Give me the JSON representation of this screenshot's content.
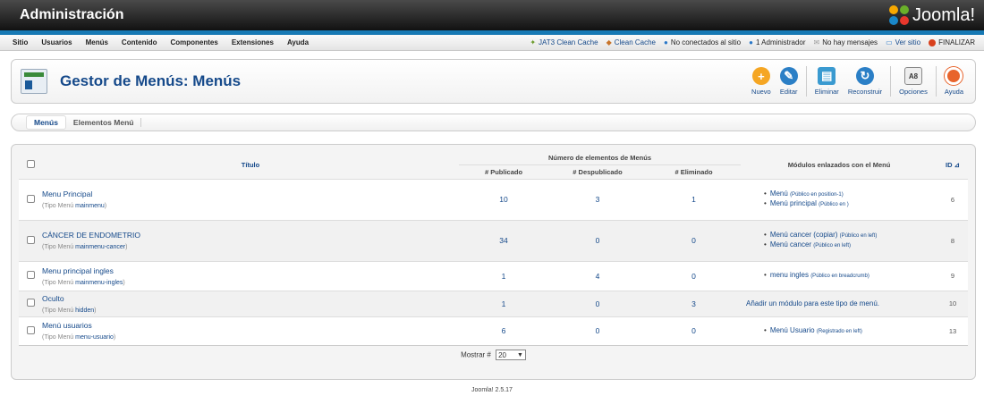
{
  "header": {
    "title": "Administración",
    "logo_text": "Joomla!"
  },
  "menubar": {
    "items": [
      "Sitio",
      "Usuarios",
      "Menús",
      "Contenido",
      "Componentes",
      "Extensiones",
      "Ayuda"
    ],
    "status": {
      "jat3": "JAT3 Clean Cache",
      "clean": "Clean Cache",
      "not_connected": "No conectados al sitio",
      "admin": "1 Administrador",
      "messages": "No hay mensajes",
      "view_site": "Ver sitio",
      "logout": "FINALIZAR"
    }
  },
  "toolbar": {
    "page_title": "Gestor de Menús: Menús",
    "new": "Nuevo",
    "edit": "Editar",
    "delete": "Eliminar",
    "rebuild": "Reconstruir",
    "options": "Opciones",
    "help": "Ayuda"
  },
  "submenu": {
    "tab1": "Menús",
    "tab2": "Elementos Menú"
  },
  "table": {
    "title_header": "Título",
    "items_group_header": "Número de elementos de Menús",
    "published_header": "# Publicado",
    "unpublished_header": "# Despublicado",
    "trashed_header": "# Eliminado",
    "modules_header": "Módulos enlazados con el Menú",
    "id_header": "ID",
    "type_label": "Tipo Menú",
    "rows": [
      {
        "title": "Menu Principal",
        "type": "mainmenu",
        "published": "10",
        "unpublished": "3",
        "trashed": "1",
        "modules": [
          {
            "name": "Menú",
            "note": "(Público en position-1)"
          },
          {
            "name": "Menú principal",
            "note": "(Público en )"
          }
        ],
        "id": "6"
      },
      {
        "title": "CÁNCER DE ENDOMETRIO",
        "type": "mainmenu-cancer",
        "published": "34",
        "unpublished": "0",
        "trashed": "0",
        "modules": [
          {
            "name": "Menú cancer (copiar)",
            "note": "(Público en left)"
          },
          {
            "name": "Menú cancer",
            "note": "(Público en left)"
          }
        ],
        "id": "8"
      },
      {
        "title": "Menu principal ingles",
        "type": "mainmenu-ingles",
        "published": "1",
        "unpublished": "4",
        "trashed": "0",
        "modules": [
          {
            "name": "menu ingles",
            "note": "(Público en breadcrumb)"
          }
        ],
        "id": "9"
      },
      {
        "title": "Oculto",
        "type": "hidden",
        "published": "1",
        "unpublished": "0",
        "trashed": "3",
        "add_module": "Añadir un módulo para este tipo de menú.",
        "id": "10"
      },
      {
        "title": "Menú usuarios",
        "type": "menu-usuario",
        "published": "6",
        "unpublished": "0",
        "trashed": "0",
        "modules": [
          {
            "name": "Menú Usuario",
            "note": "(Registrado en left)"
          }
        ],
        "id": "13"
      }
    ],
    "show_label": "Mostrar #",
    "show_value": "20"
  },
  "footer": {
    "version": "Joomla! 2.5.17"
  },
  "colors": {
    "link": "#15498a",
    "header_bar": "#1779b4"
  }
}
